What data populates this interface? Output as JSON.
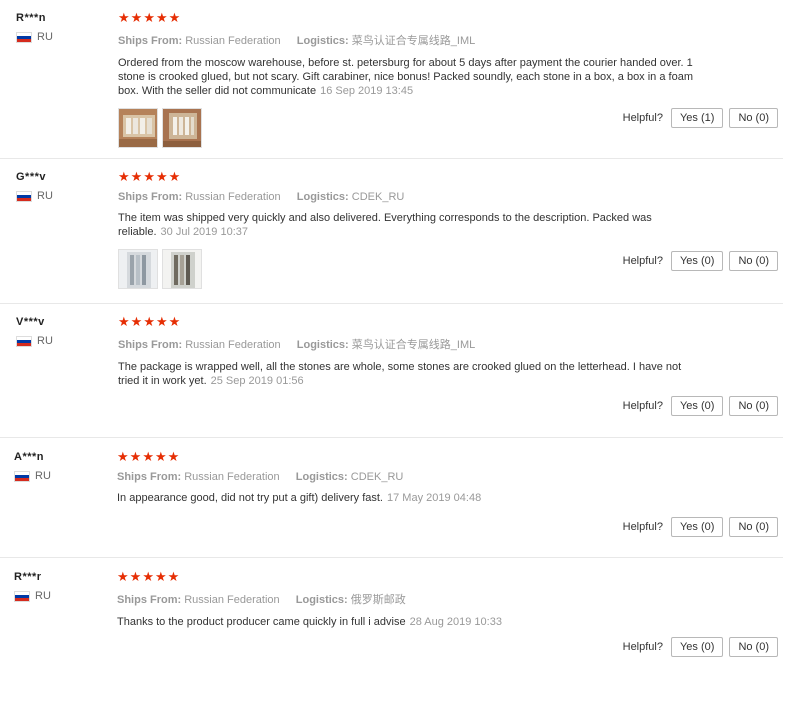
{
  "helpful_label": "Helpful?",
  "ships_from_label": "Ships From:",
  "logistics_label": "Logistics:",
  "reviews": [
    {
      "user": "R***n",
      "country": "RU",
      "stars": 5,
      "ships_from": "Russian Federation",
      "logistics": "菜鸟认证合专属线路_IML",
      "text": "Ordered from the moscow warehouse, before st. petersburg for about 5 days after payment the courier handed over. 1 stone is crooked glued, but not scary. Gift carabiner, nice bonus! Packed soundly, each stone in a box, a box in a foam box. With the seller did not communicate",
      "date": "16 Sep 2019 13:45",
      "yes_label": "Yes (1)",
      "no_label": "No (0)",
      "photos": 2
    },
    {
      "user": "G***v",
      "country": "RU",
      "stars": 5,
      "ships_from": "Russian Federation",
      "logistics": "CDEK_RU",
      "text": "The item was shipped very quickly and also delivered. Everything corresponds to the description. Packed was reliable.",
      "date": "30 Jul 2019 10:37",
      "yes_label": "Yes (0)",
      "no_label": "No (0)",
      "photos": 2
    },
    {
      "user": "V***v",
      "country": "RU",
      "stars": 5,
      "ships_from": "Russian Federation",
      "logistics": "菜鸟认证合专属线路_IML",
      "text": "The package is wrapped well, all the stones are whole, some stones are crooked glued on the letterhead. I have not tried it in work yet.",
      "date": "25 Sep 2019 01:56",
      "yes_label": "Yes (0)",
      "no_label": "No (0)",
      "photos": 0
    },
    {
      "user": "A***n",
      "country": "RU",
      "stars": 5,
      "ships_from": "Russian Federation",
      "logistics": "CDEK_RU",
      "text": "In appearance good, did not try put a gift) delivery fast.",
      "date": "17 May 2019 04:48",
      "yes_label": "Yes (0)",
      "no_label": "No (0)",
      "photos": 0
    },
    {
      "user": "R***r",
      "country": "RU",
      "stars": 5,
      "ships_from": "Russian Federation",
      "logistics": "俄罗斯邮政",
      "text": "Thanks to the product producer came quickly in full i advise",
      "date": "28 Aug 2019 10:33",
      "yes_label": "Yes (0)",
      "no_label": "No (0)",
      "photos": 0
    }
  ]
}
